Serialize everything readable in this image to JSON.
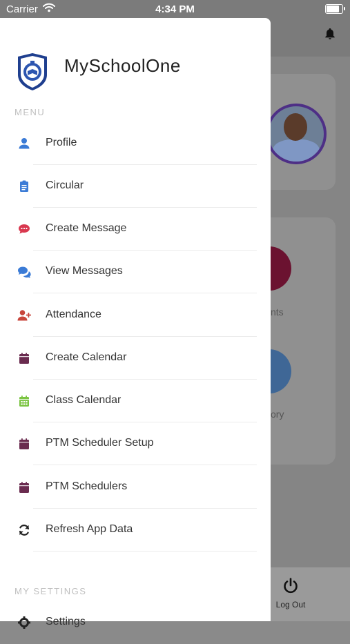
{
  "status_bar": {
    "carrier": "Carrier",
    "time": "4:34 PM",
    "battery_level": 0.9
  },
  "background": {
    "label_1": "nts",
    "label_2": "ory",
    "logout_label": "Log Out"
  },
  "drawer": {
    "app_name": "MySchoolOne",
    "menu_header": "MENU",
    "items": [
      {
        "label": "Profile",
        "icon": "user-icon",
        "color": "#3b7bd6"
      },
      {
        "label": "Circular",
        "icon": "clipboard-icon",
        "color": "#3b7bd6"
      },
      {
        "label": "Create Message",
        "icon": "chat-bubble-icon",
        "color": "#d9384f"
      },
      {
        "label": "View Messages",
        "icon": "chat-bubbles-icon",
        "color": "#3b7bd6"
      },
      {
        "label": "Attendance",
        "icon": "user-plus-icon",
        "color": "#c8453b"
      },
      {
        "label": "Create Calendar",
        "icon": "calendar-icon",
        "color": "#6a2b4f"
      },
      {
        "label": "Class Calendar",
        "icon": "calendar-grid-icon",
        "color": "#7bc442"
      },
      {
        "label": "PTM Scheduler Setup",
        "icon": "calendar-icon",
        "color": "#6a2b4f"
      },
      {
        "label": "PTM Schedulers",
        "icon": "calendar-icon",
        "color": "#6a2b4f"
      },
      {
        "label": "Refresh App Data",
        "icon": "refresh-icon",
        "color": "#222222"
      }
    ],
    "settings_header": "MY SETTINGS",
    "settings_items": [
      {
        "label": "Settings",
        "icon": "gear-icon",
        "color": "#222222"
      }
    ]
  }
}
